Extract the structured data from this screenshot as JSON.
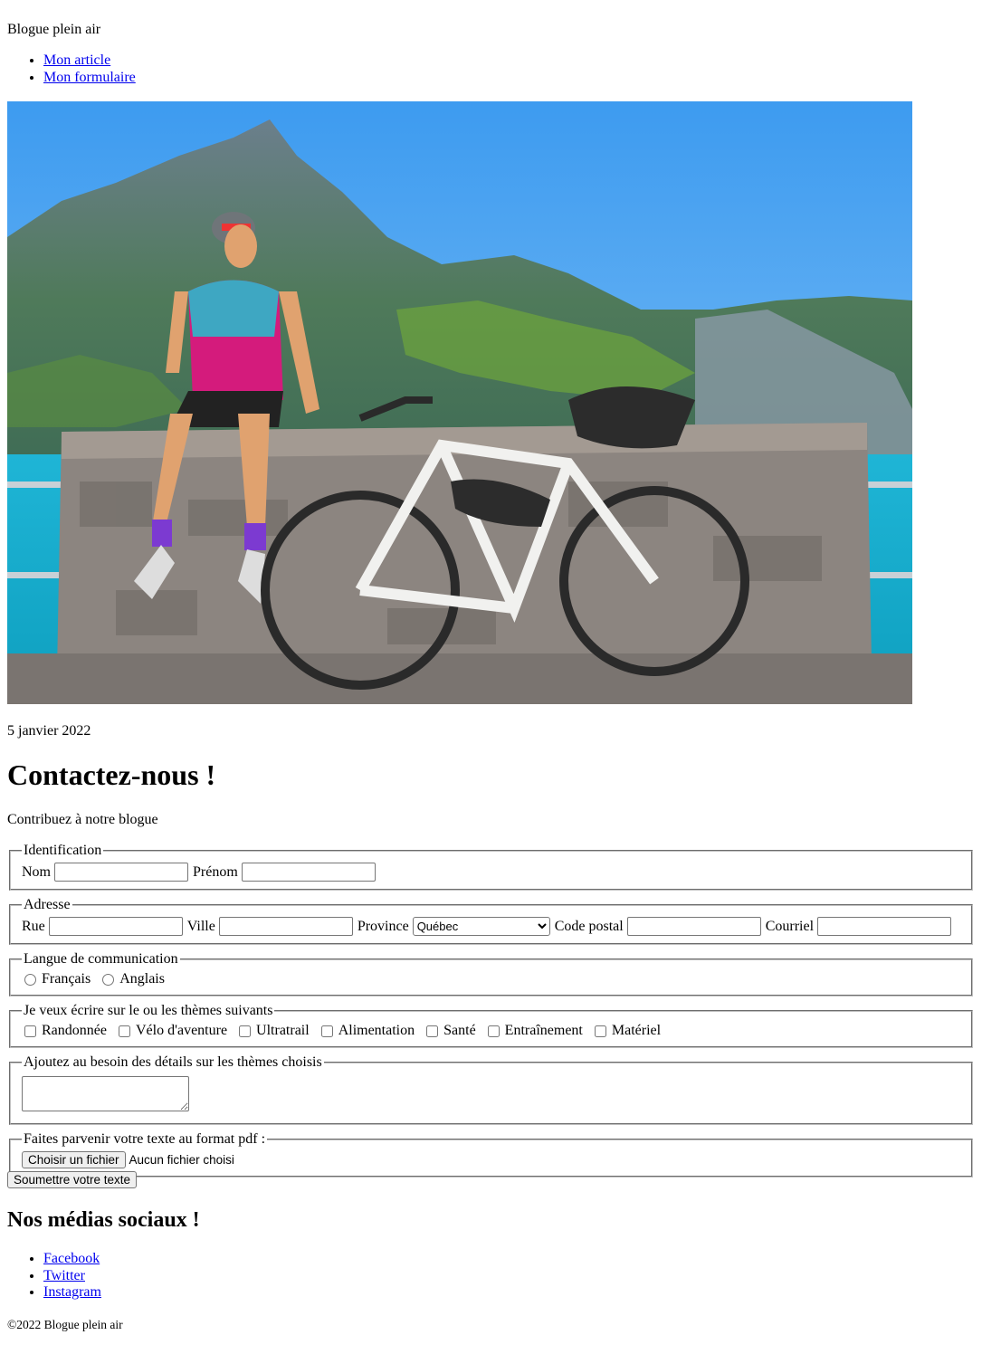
{
  "header": {
    "site_title": "Blogue plein air",
    "nav": [
      "Mon article",
      "Mon formulaire"
    ]
  },
  "hero": {
    "image": "cyclist-with-bike-mountains-lake-photo"
  },
  "article": {
    "date": "5 janvier 2022",
    "title": "Contactez-nous !",
    "subtitle": "Contribuez à notre blogue"
  },
  "form": {
    "identification": {
      "legend": "Identification",
      "nom_label": "Nom",
      "prenom_label": "Prénom"
    },
    "adresse": {
      "legend": "Adresse",
      "rue_label": "Rue",
      "ville_label": "Ville",
      "province_label": "Province",
      "province_value": "Québec",
      "code_postal_label": "Code postal",
      "courriel_label": "Courriel"
    },
    "langue": {
      "legend": "Langue de communication",
      "options": [
        "Français",
        "Anglais"
      ]
    },
    "themes": {
      "legend": "Je veux écrire sur le ou les thèmes suivants",
      "options": [
        "Randonnée",
        "Vélo d'aventure",
        "Ultratrail",
        "Alimentation",
        "Santé",
        "Entraînement",
        "Matériel"
      ]
    },
    "details": {
      "legend": "Ajoutez au besoin des détails sur les thèmes choisis"
    },
    "fichier": {
      "legend": "Faites parvenir votre texte au format pdf :",
      "button_label": "Choisir un fichier",
      "status": "Aucun fichier choisi"
    },
    "submit_label": "Soumettre votre texte"
  },
  "social": {
    "heading": "Nos médias sociaux !",
    "links": [
      "Facebook",
      "Twitter",
      "Instagram"
    ]
  },
  "footer": {
    "text": "©2022 Blogue plein air"
  }
}
